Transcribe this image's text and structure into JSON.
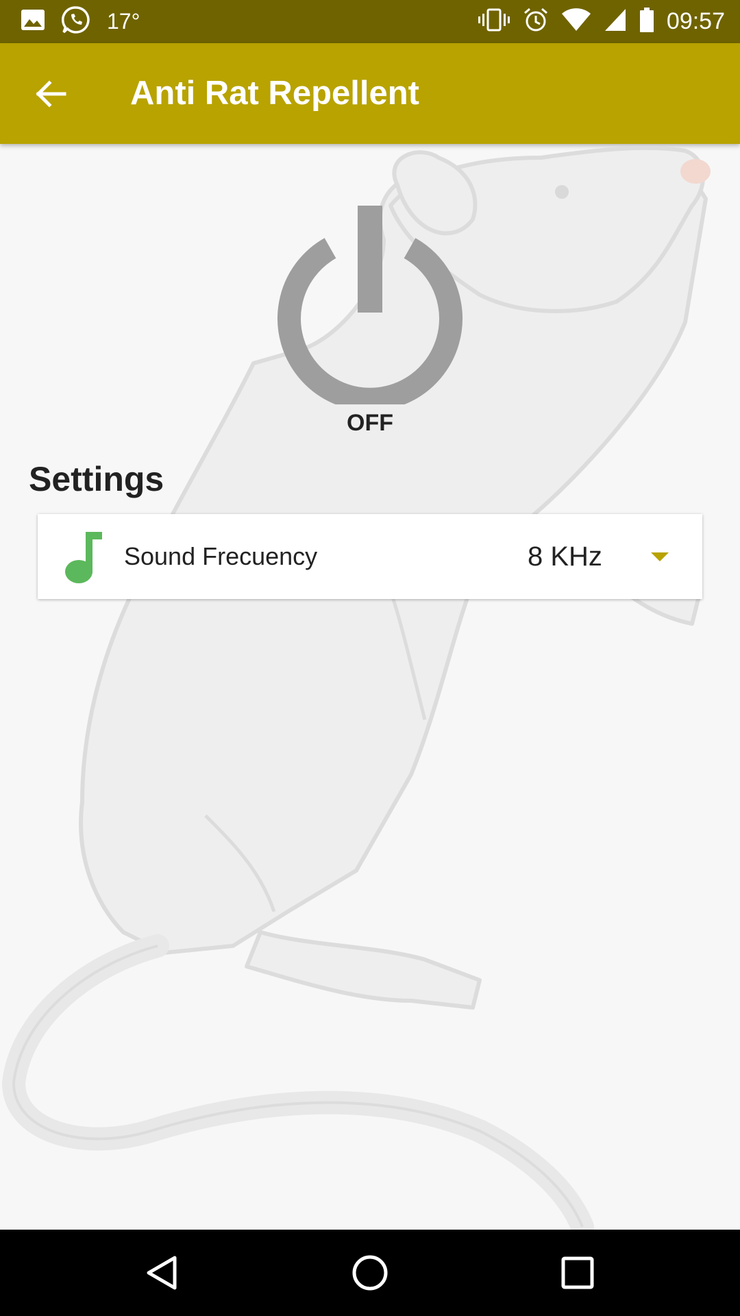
{
  "status_bar": {
    "temperature": "17°",
    "time": "09:57",
    "icons_left": [
      "image-icon",
      "whatsapp-icon"
    ],
    "icons_right": [
      "vibrate-icon",
      "alarm-icon",
      "wifi-icon",
      "signal-icon",
      "battery-icon"
    ]
  },
  "app_bar": {
    "title": "Anti Rat Repellent",
    "back_icon": "arrow-back-icon"
  },
  "power": {
    "state_label": "OFF",
    "icon": "power-icon"
  },
  "settings": {
    "title": "Settings",
    "items": [
      {
        "icon": "music-note-icon",
        "label": "Sound Frecuency",
        "value": "8 KHz",
        "dropdown_icon": "dropdown-arrow-icon"
      }
    ]
  },
  "nav_bar": {
    "buttons": [
      "back-triangle-icon",
      "home-circle-icon",
      "recents-square-icon"
    ]
  },
  "colors": {
    "status_bar": "#6f6300",
    "app_bar": "#b8a300",
    "power_icon": "#9e9e9e",
    "note_icon": "#5cb85c",
    "dropdown_arrow": "#b8a300",
    "background": "#f7f7f7"
  }
}
